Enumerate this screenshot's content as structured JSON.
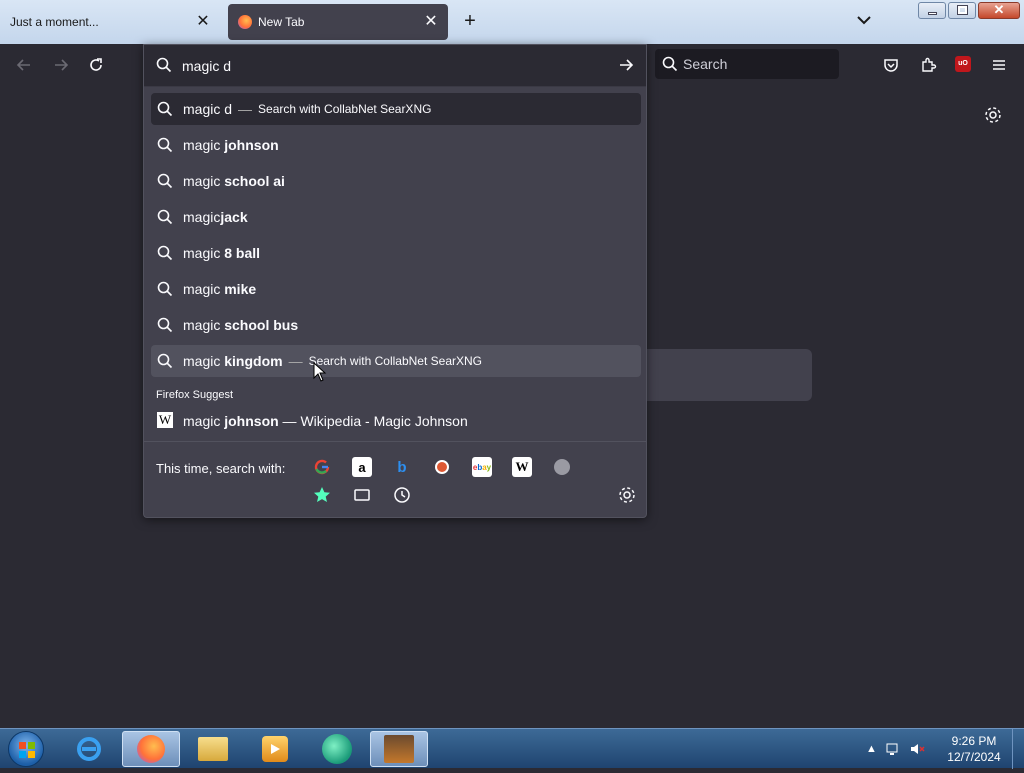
{
  "tabs": [
    {
      "title": "Just a moment...",
      "active": false
    },
    {
      "title": "New Tab",
      "active": true
    }
  ],
  "urlbar": {
    "value": "magic d",
    "suggestions": [
      {
        "prefix": "magic d",
        "bold": "",
        "sep": "—",
        "action": "Search with CollabNet SearXNG",
        "state": "selected"
      },
      {
        "prefix": "magic ",
        "bold": "johnson",
        "sep": "",
        "action": "",
        "state": ""
      },
      {
        "prefix": "magic ",
        "bold": "school ai",
        "sep": "",
        "action": "",
        "state": ""
      },
      {
        "prefix": "magic",
        "bold": "jack",
        "sep": "",
        "action": "",
        "state": ""
      },
      {
        "prefix": "magic ",
        "bold": "8 ball",
        "sep": "",
        "action": "",
        "state": ""
      },
      {
        "prefix": "magic ",
        "bold": "mike",
        "sep": "",
        "action": "",
        "state": ""
      },
      {
        "prefix": "magic ",
        "bold": "school bus",
        "sep": "",
        "action": "",
        "state": ""
      },
      {
        "prefix": "magic ",
        "bold": "kingdom",
        "sep": "—",
        "action": "Search with CollabNet SearXNG",
        "state": "hover"
      }
    ],
    "suggest_group_label": "Firefox Suggest",
    "wiki_result": {
      "prefix": "magic ",
      "bold": "johnson",
      "suffix": " — Wikipedia - Magic Johnson",
      "icon": "W"
    },
    "oneoff_label": "This time, search with:",
    "engines": [
      "Google",
      "Amazon",
      "Bing",
      "DuckDuckGo",
      "eBay",
      "Wikipedia",
      "Search engine"
    ],
    "modes": [
      "bookmarks",
      "tabs",
      "history"
    ]
  },
  "searchbar": {
    "placeholder": "Search"
  },
  "extensions": {
    "ublock_label": "uO"
  },
  "taskbar": {
    "time": "9:26 PM",
    "date": "12/7/2024",
    "apps": [
      "internet-explorer",
      "firefox",
      "file-explorer",
      "media-player",
      "browser-app",
      "image-viewer"
    ]
  },
  "colors": {
    "page_bg": "#2b2a33",
    "popup_bg": "#42414d",
    "accent": "#0060df"
  }
}
